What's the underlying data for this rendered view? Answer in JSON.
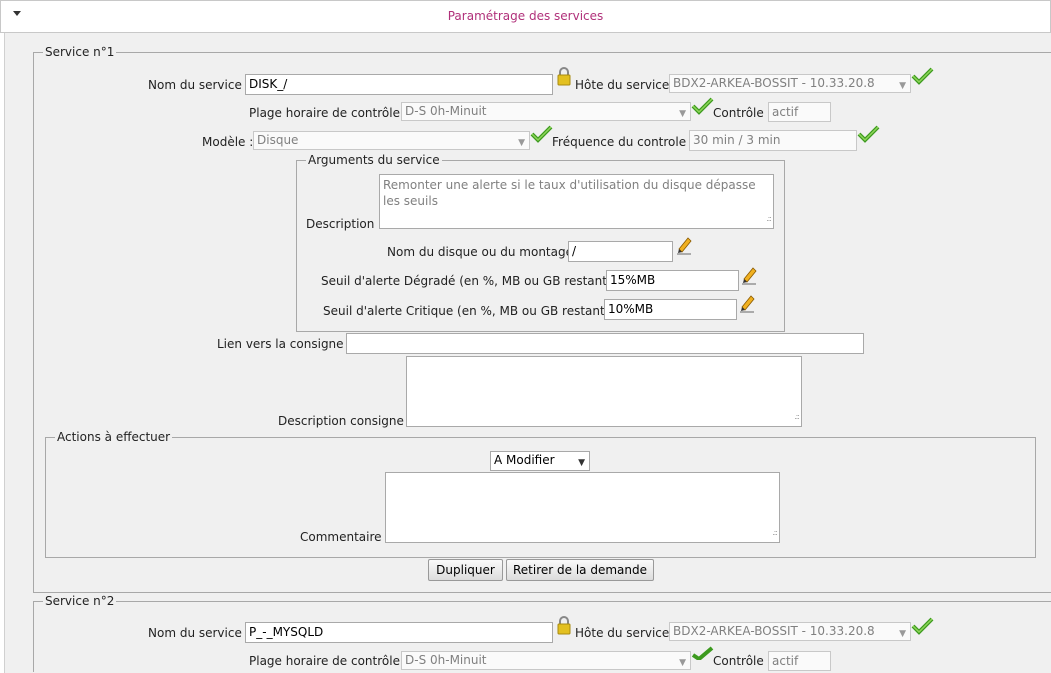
{
  "header": {
    "title": "Paramétrage des services"
  },
  "service1": {
    "legend": "Service n°1",
    "nom_label": "Nom du service :",
    "nom_value": "DISK_/",
    "hote_label": "Hôte du service:",
    "hote_value": "BDX2-ARKEA-BOSSIT - 10.33.20.8",
    "plage_label": "Plage horaire de contrôle :",
    "plage_value": "D-S 0h-Minuit",
    "controle_label": "Contrôle :",
    "controle_value": "actif",
    "modele_label": "Modèle :",
    "modele_value": "Disque",
    "freq_label": "Fréquence du controle :",
    "freq_value": "30 min / 3 min",
    "args": {
      "legend": "Arguments du service",
      "description_label": "Description :",
      "description_value": "Remonter une alerte si le taux d'utilisation du disque dépasse les seuils",
      "disque_label": "Nom du disque ou du montage:",
      "disque_value": "/",
      "degrade_label": "Seuil d'alerte Dégradé (en %, MB ou GB restant):",
      "degrade_value": "15%MB",
      "critique_label": "Seuil d'alerte Critique (en %, MB ou GB restant):",
      "critique_value": "10%MB"
    },
    "consigne_label": "Lien vers la consigne :",
    "consigne_value": "",
    "desc_consigne_label": "Description consigne :",
    "desc_consigne_value": "",
    "actions": {
      "legend": "Actions à effectuer",
      "select_value": "A Modifier",
      "commentaire_label": "Commentaire :",
      "commentaire_value": ""
    },
    "dupliquer_label": "Dupliquer",
    "retirer_label": "Retirer de la demande"
  },
  "service2": {
    "legend": "Service n°2",
    "nom_label": "Nom du service :",
    "nom_value": "P_-_MYSQLD",
    "hote_label": "Hôte du service:",
    "hote_value": "BDX2-ARKEA-BOSSIT - 10.33.20.8",
    "plage_label": "Plage horaire de contrôle :",
    "plage_value": "D-S 0h-Minuit",
    "controle_label": "Contrôle :",
    "controle_value": "actif"
  }
}
